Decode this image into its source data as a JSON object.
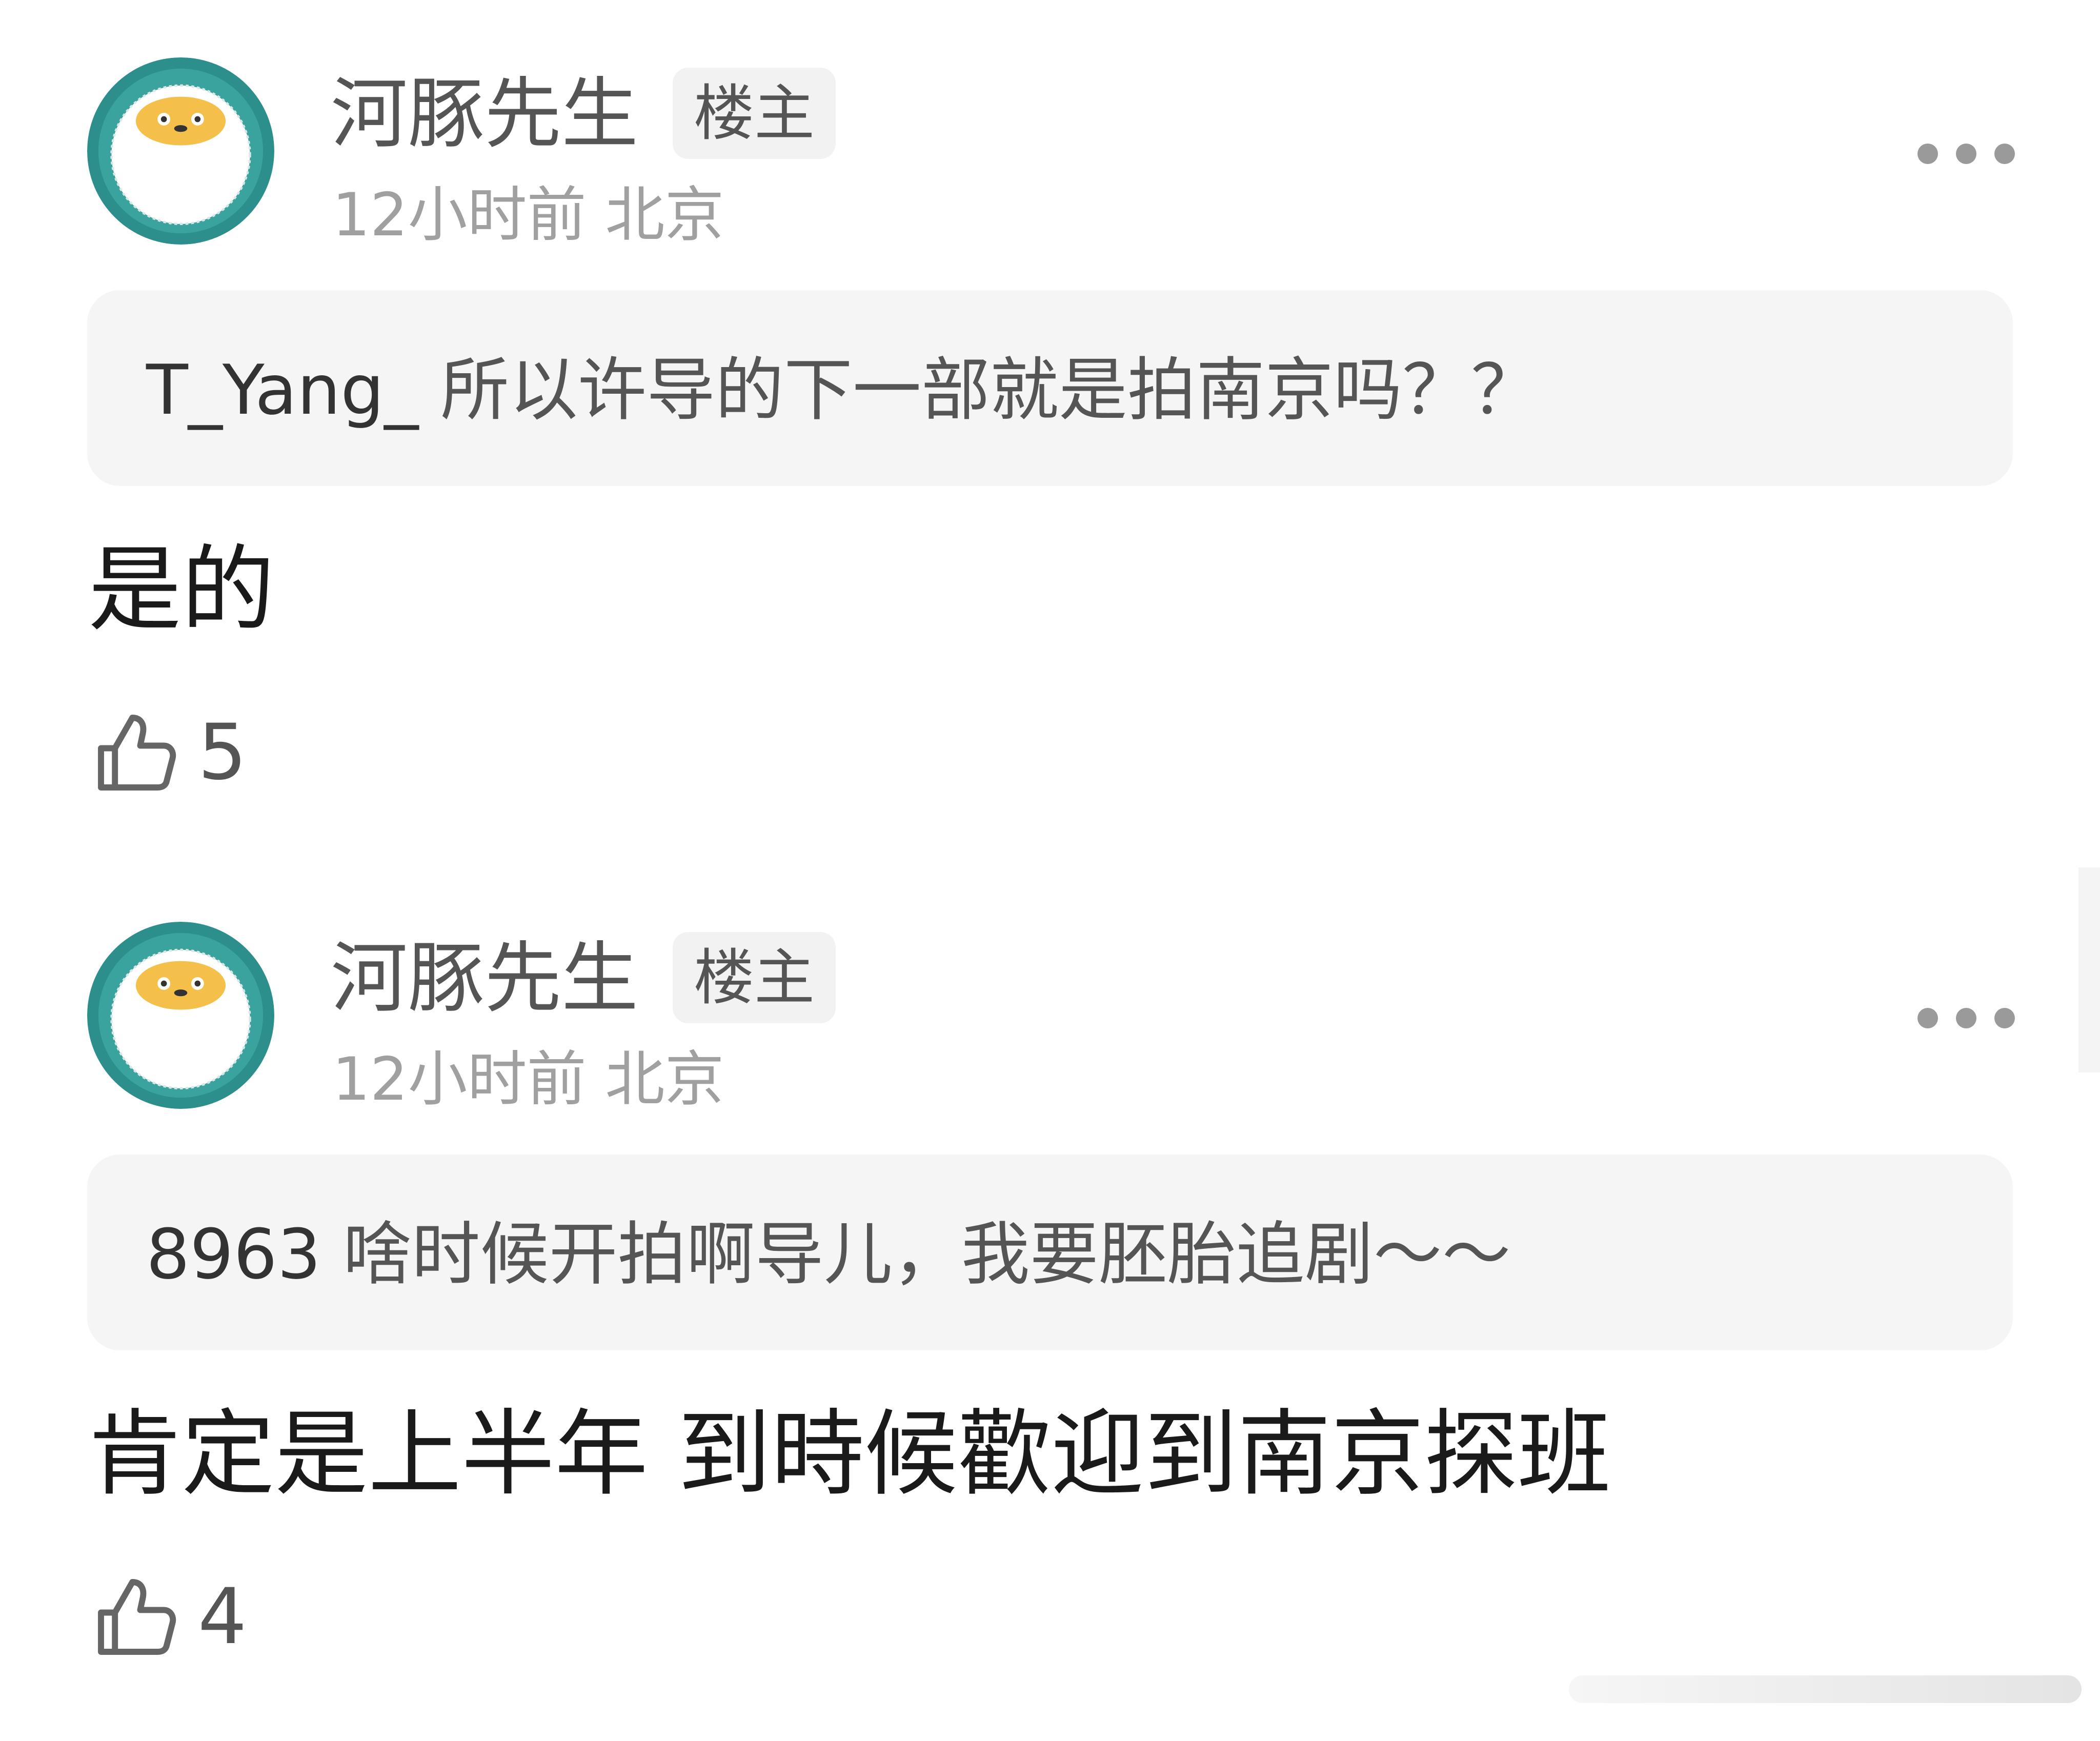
{
  "comments": [
    {
      "username": "河豚先生",
      "badge": "楼主",
      "time": "12小时前",
      "location": "北京",
      "quote_user": "T_Yang_",
      "quote_text": "所以许导的下一部就是拍南京吗？？",
      "text": "是的",
      "likes": "5",
      "avatar_icon": "pufferfish-avatar",
      "more_icon": "more-dots-icon",
      "like_icon": "thumbs-up-icon"
    },
    {
      "username": "河豚先生",
      "badge": "楼主",
      "time": "12小时前",
      "location": "北京",
      "quote_user": "8963",
      "quote_text": "啥时候开拍啊导儿，我要胚胎追剧～～",
      "text": "肯定是上半年 到時候歡迎到南京探班",
      "likes": "4",
      "avatar_icon": "pufferfish-avatar",
      "more_icon": "more-dots-icon",
      "like_icon": "thumbs-up-icon"
    }
  ],
  "colors": {
    "username": "#555555",
    "meta": "#a0a0a0",
    "body": "#1a1a1a",
    "quote_bg": "#f5f5f5",
    "badge_bg": "#f2f2f2",
    "avatar_teal": "#2c8f8c"
  }
}
